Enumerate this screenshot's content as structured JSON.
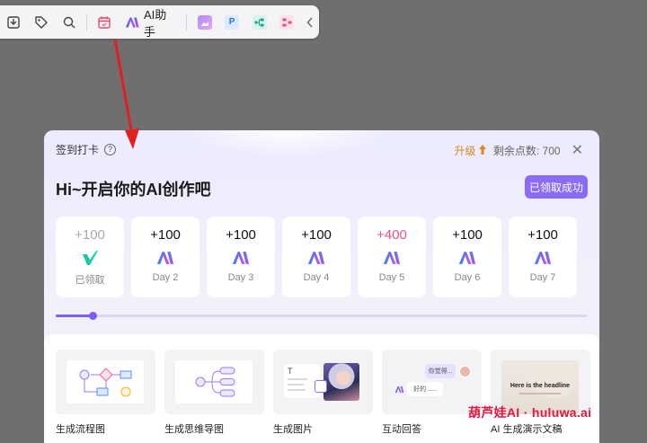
{
  "toolbar": {
    "ai_helper_label": "AI助手",
    "icons": [
      "download-icon",
      "tag-icon",
      "search-icon",
      "calendar-icon",
      "ai-logo-icon",
      "image-app-icon",
      "p-app-icon",
      "flow-app-icon",
      "mindmap-app-icon",
      "collapse-icon"
    ],
    "p_letter": "P"
  },
  "modal": {
    "title": "签到打卡",
    "help_glyph": "?",
    "upgrade_label": "升级",
    "points_label": "剩余点数: 700",
    "close_glyph": "✕",
    "greeting": "Hi~开启你的AI创作吧",
    "claimed_button": "已领取成功",
    "days": [
      {
        "points": "+100",
        "label": "已领取",
        "state": "claimed"
      },
      {
        "points": "+100",
        "label": "Day 2",
        "state": "normal"
      },
      {
        "points": "+100",
        "label": "Day 3",
        "state": "normal"
      },
      {
        "points": "+100",
        "label": "Day 4",
        "state": "normal"
      },
      {
        "points": "+400",
        "label": "Day 5",
        "state": "bonus"
      },
      {
        "points": "+100",
        "label": "Day 6",
        "state": "normal"
      },
      {
        "points": "+100",
        "label": "Day 7",
        "state": "normal"
      }
    ],
    "progress": 0.07
  },
  "features": [
    {
      "label": "生成流程图"
    },
    {
      "label": "生成思维导图"
    },
    {
      "label": "生成图片"
    },
    {
      "label": "互动回答",
      "bubble1": "你觉得...",
      "bubble2": "好的......"
    },
    {
      "label": "AI 生成演示文稿",
      "headline": "Here is the headline"
    }
  ],
  "watermark": "葫芦娃AI · huluwa.ai",
  "colors": {
    "accent": "#8b6cf6",
    "arrow": "#e02020",
    "bonus": "#f0508a",
    "upgrade": "#d98a1a"
  }
}
